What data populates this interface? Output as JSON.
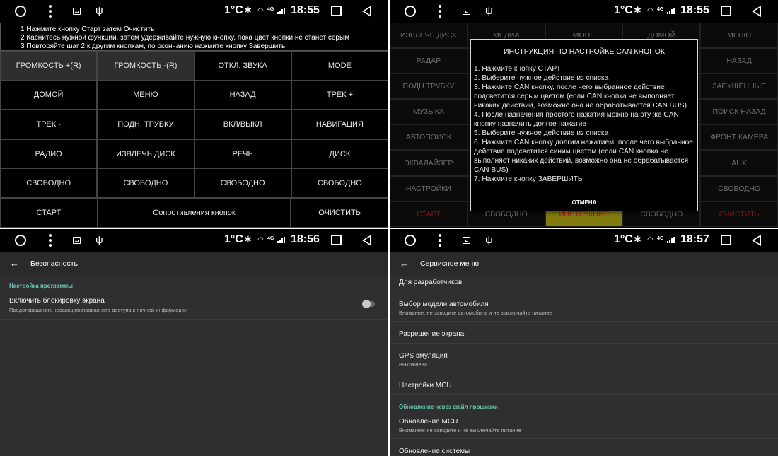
{
  "status": {
    "temperature": "1°C",
    "bt_icon": "bluetooth-icon",
    "network": "4G",
    "times": [
      "18:55",
      "18:55",
      "18:56",
      "18:57"
    ]
  },
  "panel1": {
    "instructions": [
      "1 Нажмите кнопку Старт затем Очистить",
      "2 Каснитесь нужной функции, затем удерживайте нужную кнопку, пока цвет кнопки не станет серым",
      "3 Повторяйте шаг 2 к другим кнопкам, по окончанию нажмите кнопку Завершить"
    ],
    "rows": [
      [
        "ГРОМКОСТЬ +(R)",
        "ГРОМКОСТЬ -(R)",
        "ОТКЛ. ЗВУКА",
        "MODE"
      ],
      [
        "ДОМОЙ",
        "МЕНЮ",
        "НАЗАД",
        "ТРЕК +"
      ],
      [
        "ТРЕК -",
        "ПОДН. ТРУБКУ",
        "ВКЛ/ВЫКЛ",
        "НАВИГАЦИЯ"
      ],
      [
        "РАДИО",
        "ИЗВЛЕЧЬ ДИСК",
        "РЕЧЬ",
        "ДИСК"
      ],
      [
        "СВОБОДНО",
        "СВОБОДНО",
        "СВОБОДНО",
        "СВОБОДНО"
      ]
    ],
    "bottom": {
      "start": "СТАРТ",
      "resistance": "Сопротивления кнопок",
      "clear": "ОЧИСТИТЬ"
    },
    "colors": {
      "highlight": "#2e2e2e"
    }
  },
  "panel2": {
    "rows": [
      [
        "ИЗВЛЕЧЬ ДИСК",
        "МЕДИА",
        "MODE",
        "ДОМОЙ",
        "МЕНЮ"
      ],
      [
        "РАДАР",
        "",
        "",
        "",
        "НАЗАД"
      ],
      [
        "ПОДН.ТРУБКУ",
        "",
        "",
        "",
        "ЗАПУЩЕННЫЕ"
      ],
      [
        "МУЗЫКА",
        "",
        "",
        "",
        "ПОИСК НАЗАД"
      ],
      [
        "АВТОПОИСК",
        "",
        "",
        "",
        "ФРОНТ КАМЕРА"
      ],
      [
        "ЭКВАЛАЙЗЕР",
        "",
        "",
        "",
        "AUX"
      ],
      [
        "НАСТРОЙКИ",
        "",
        "",
        "",
        "СВОБОДНО"
      ],
      [
        "СТАРТ",
        "СВОБОДНО",
        "ИНСТРУКЦИЯ",
        "СВОБОДНО",
        "ОЧИСТИТЬ"
      ]
    ],
    "dialog": {
      "title": "ИНСТРУКЦИЯ ПО НАСТРОЙКЕ CAN КНОПОК",
      "lines": [
        "1. Нажмите кнопку СТАРТ",
        "2. Выберите нужное действие из списка",
        "3. Нажмите CAN кнопку, после чего выбранное действие подсветится серым цветом (если CAN кнопка не выполняет никаких действий, возможно она не обрабатывается CAN BUS)",
        "4. После назначения простого нажатия можно на эту же CAN кнопку назначить долгое нажатие",
        "5. Выберите нужное действие из списка",
        "6. Нажмите CAN кнопку долгим нажатием, после чего выбранное действие подсветится синим цветом (если CAN кнопка не выполняет никаких действий, возможно она не обрабатывается CAN BUS)",
        "7. Нажмите кнопку ЗАВЕРШИТЬ"
      ],
      "cancel": "ОТМЕНА"
    },
    "colors": {
      "instruction_bg": "#807a10",
      "red_text": "#b31414"
    }
  },
  "panel3": {
    "title": "Безопасность",
    "section": "Настройка программы",
    "item_title": "Включить блокировку экрана",
    "item_summary": "Предотвращение несанкционированного доступа к личной информации",
    "toggle_state": "off",
    "colors": {
      "section": "#65c8b6"
    }
  },
  "panel4": {
    "title": "Сервисное меню",
    "items": [
      {
        "title": "Для разработчиков",
        "summary": ""
      },
      {
        "title": "Выбор модели автомобиля",
        "summary": "Внимание: не заводите автомобиль и не выключайте питание"
      },
      {
        "title": "Разрешение экрана",
        "summary": ""
      },
      {
        "title": "GPS эмуляция",
        "summary": "Выключена"
      },
      {
        "title": "Настройки MCU",
        "summary": ""
      }
    ],
    "section": "Обновление через файл прошивки",
    "items2": [
      {
        "title": "Обновление MCU",
        "summary": "Внимание: не заводите и не выключайте питание"
      },
      {
        "title": "Обновление системы",
        "summary": ""
      }
    ]
  }
}
